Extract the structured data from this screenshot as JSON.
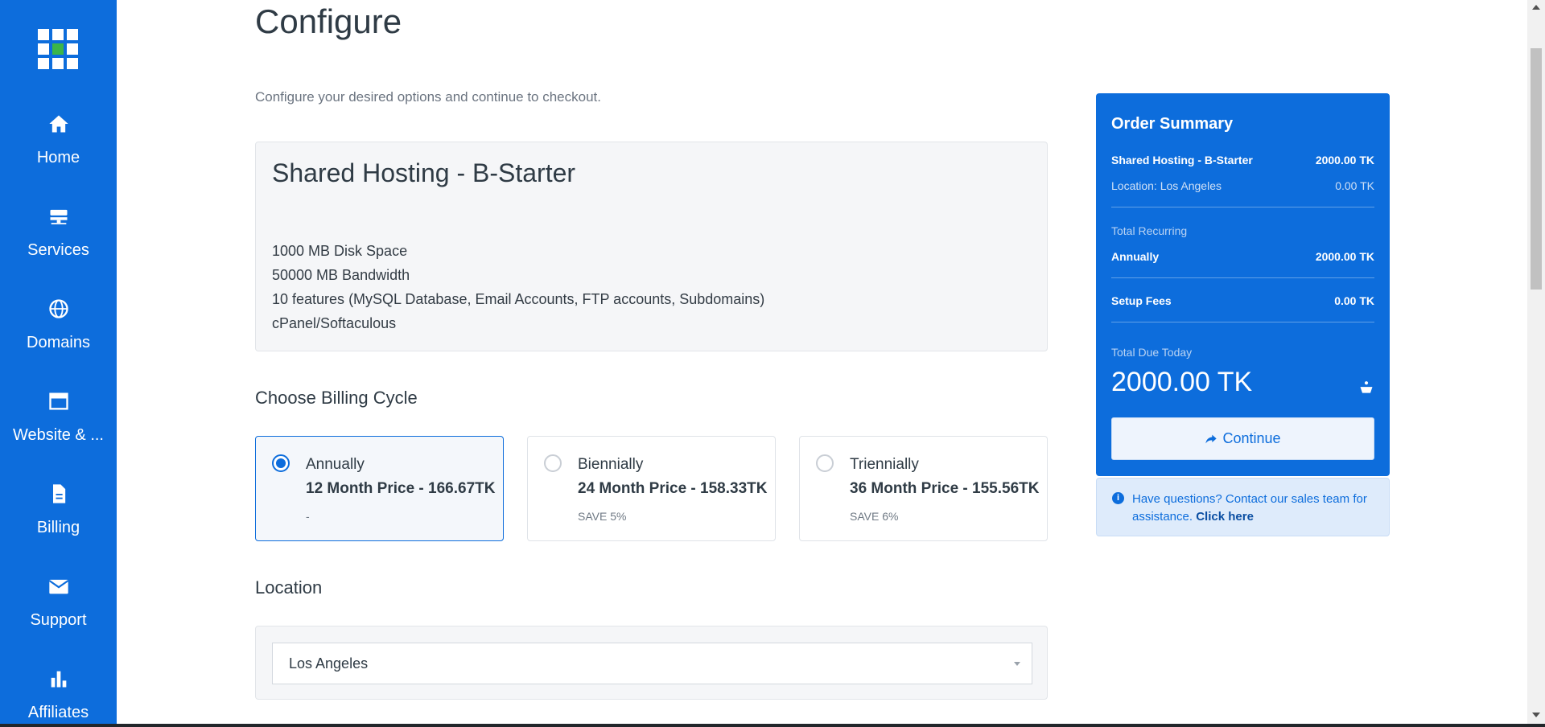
{
  "sidebar": {
    "items": [
      {
        "label": "Home",
        "icon": "home-icon"
      },
      {
        "label": "Services",
        "icon": "server-icon"
      },
      {
        "label": "Domains",
        "icon": "globe-icon"
      },
      {
        "label": "Website & ...",
        "icon": "browser-window-icon"
      },
      {
        "label": "Billing",
        "icon": "document-icon"
      },
      {
        "label": "Support",
        "icon": "envelope-icon"
      },
      {
        "label": "Affiliates",
        "icon": "bar-chart-icon"
      }
    ]
  },
  "main": {
    "title": "Configure",
    "subtitle": "Configure your desired options and continue to checkout.",
    "product": {
      "name": "Shared Hosting - B-Starter",
      "features": [
        "1000 MB Disk Space",
        "50000 MB Bandwidth",
        "10 features (MySQL Database, Email Accounts, FTP accounts, Subdomains)",
        "cPanel/Softaculous"
      ]
    },
    "billing": {
      "heading": "Choose Billing Cycle",
      "options": [
        {
          "name": "Annually",
          "price": "12 Month Price - 166.67TK",
          "save": "-",
          "selected": true
        },
        {
          "name": "Biennially",
          "price": "24 Month Price - 158.33TK",
          "save": "SAVE 5%",
          "selected": false
        },
        {
          "name": "Triennially",
          "price": "36 Month Price - 155.56TK",
          "save": "SAVE 6%",
          "selected": false
        }
      ]
    },
    "location": {
      "heading": "Location",
      "selected": "Los Angeles"
    }
  },
  "summary": {
    "title": "Order Summary",
    "product_label": "Shared Hosting - B-Starter",
    "product_price": "2000.00 TK",
    "location_label": "Location: Los Angeles",
    "location_price": "0.00 TK",
    "total_recurring_label": "Total Recurring",
    "recurring_cycle": "Annually",
    "recurring_price": "2000.00 TK",
    "setup_label": "Setup Fees",
    "setup_price": "0.00 TK",
    "total_due_label": "Total Due Today",
    "total_due": "2000.00 TK",
    "continue_label": "Continue"
  },
  "help": {
    "text": "Have questions? Contact our sales team for assistance.",
    "link": "Click here"
  },
  "colors": {
    "brand": "#0d6ddc",
    "logo_accent": "#3bb54a"
  }
}
